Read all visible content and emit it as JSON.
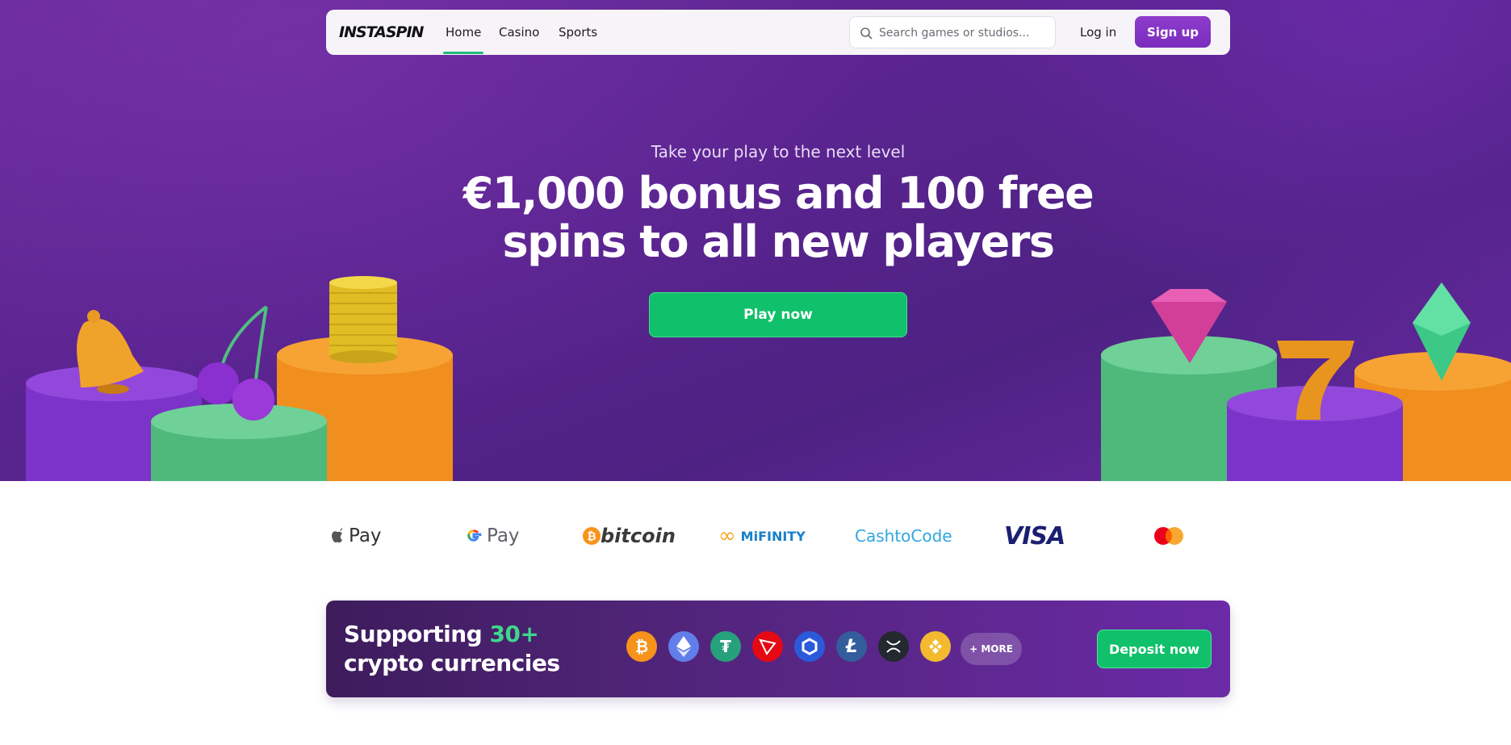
{
  "nav": {
    "logo": "INSTASPIN",
    "links": [
      "Home",
      "Casino",
      "Sports"
    ],
    "search_placeholder": "Search games or studios...",
    "login_label": "Log in",
    "signup_label": "Sign up"
  },
  "hero": {
    "subtitle": "Take your play to the next level",
    "headline_line1": "€1,000 bonus and 100 free",
    "headline_line2": "spins to all new players",
    "cta_label": "Play now"
  },
  "payments": {
    "methods": [
      "Pay",
      "Pay",
      "bitcoin",
      "MiFINITY",
      "CashtoCode",
      "VISA"
    ],
    "icons": [
      "apple-pay",
      "google-pay",
      "bitcoin",
      "mifinity",
      "cashtocode",
      "visa",
      "mastercard"
    ]
  },
  "crypto_banner": {
    "title_prefix": "Supporting ",
    "title_accent": "30+",
    "title_line2": "crypto currencies",
    "coins": [
      "bitcoin",
      "ethereum",
      "tether",
      "tron",
      "chainlink",
      "litecoin",
      "xrp",
      "binance"
    ],
    "more_label": "+ MORE",
    "deposit_label": "Deposit now"
  },
  "colors": {
    "brand_purple": "#7a2cbd",
    "cta_green": "#10c06a",
    "accent_green": "#3fd68b"
  }
}
